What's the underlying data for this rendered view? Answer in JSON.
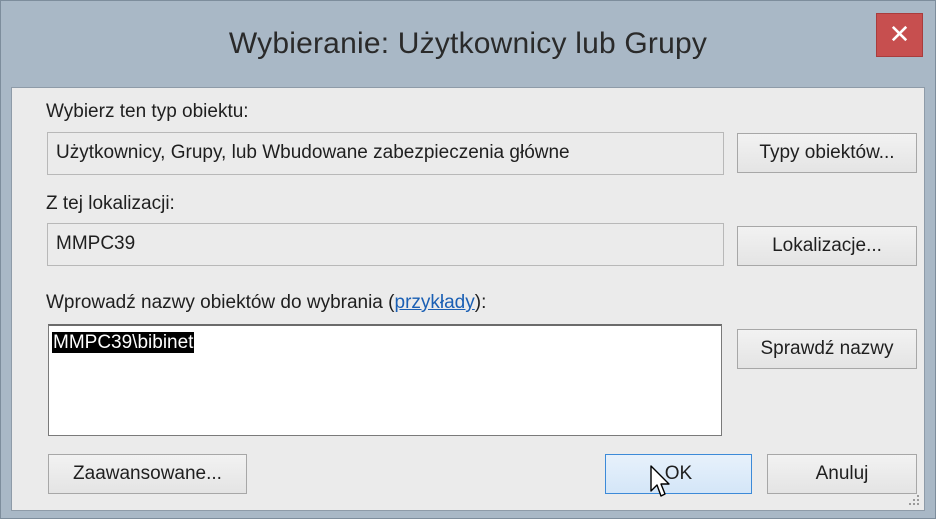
{
  "window": {
    "title": "Wybieranie: Użytkownicy lub Grupy",
    "close_glyph": "✕"
  },
  "object_type": {
    "label": "Wybierz ten typ obiektu:",
    "value": "Użytkownicy, Grupy, lub Wbudowane zabezpieczenia główne",
    "button_label": "Typy obiektów..."
  },
  "location": {
    "label": "Z tej lokalizacji:",
    "value": "MMPC39",
    "button_label": "Lokalizacje..."
  },
  "names": {
    "label_prefix": "Wprowadź nazwy obiektów do wybrania (",
    "label_link": "przykłady",
    "label_suffix": "):",
    "value": "MMPC39\\bibinet",
    "check_button_label": "Sprawdź nazwy"
  },
  "footer": {
    "advanced_label": "Zaawansowane...",
    "ok_label": "OK",
    "cancel_label": "Anuluj"
  },
  "icons": {
    "close": "close-icon",
    "cursor": "arrow-cursor-icon",
    "resize": "resize-grip-icon"
  },
  "colors": {
    "close_button": "#c74f4f",
    "title_bar": "#a9b8c6",
    "dialog_bg": "#ebebeb",
    "primary_border": "#3c8ad8",
    "link": "#1a5fb4"
  }
}
